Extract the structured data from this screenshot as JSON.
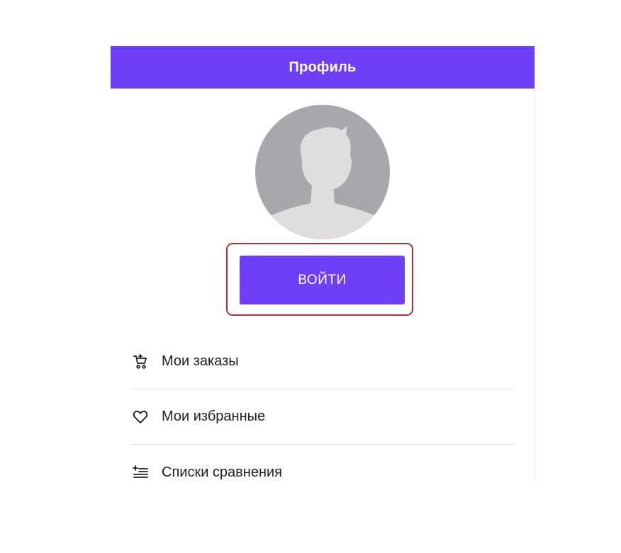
{
  "header": {
    "title": "Профиль",
    "background": "#6e3ff7"
  },
  "avatar": {
    "icon": "user-silhouette-icon",
    "background": "#a8a8aa"
  },
  "login": {
    "label": "ВОЙТИ",
    "highlight_color": "#b0303a"
  },
  "menu": {
    "items": [
      {
        "label": "Мои заказы",
        "icon": "cart-icon"
      },
      {
        "label": "Мои избранные",
        "icon": "heart-icon"
      },
      {
        "label": "Списки сравнения",
        "icon": "compare-list-icon"
      }
    ]
  }
}
